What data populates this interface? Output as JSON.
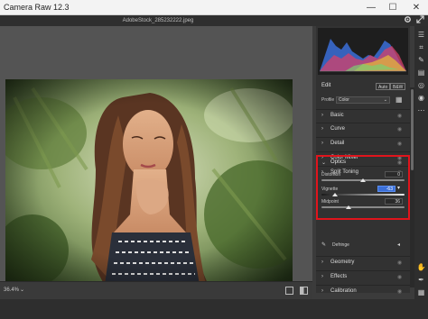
{
  "window": {
    "title": "Camera Raw 12.3",
    "minimize": "—",
    "maximize": "☐",
    "close": "✕"
  },
  "document": {
    "filename": "AdobeStock_285232222.jpeg"
  },
  "top_icons": {
    "settings": "gear-icon",
    "fullscreen": "expand-icon"
  },
  "status": {
    "zoom": "36.4%",
    "zoom_caret": "⌄"
  },
  "edit_panel": {
    "title": "Edit",
    "auto_button": "Auto",
    "bw_button": "B&W",
    "profile_label": "Profile",
    "profile_value": "Color",
    "profile_caret": "⌄"
  },
  "sections": [
    {
      "label": "Basic",
      "expanded": false
    },
    {
      "label": "Curve",
      "expanded": false
    },
    {
      "label": "Detail",
      "expanded": false
    },
    {
      "label": "Color Mixer",
      "expanded": false
    },
    {
      "label": "Split Toning",
      "expanded": false
    },
    {
      "label": "Optics",
      "expanded": true
    }
  ],
  "optics": {
    "sliders": [
      {
        "label": "Distortion",
        "value": "0",
        "position": 0.5
      },
      {
        "label": "Vignette",
        "value": "-63",
        "position": 0.19
      },
      {
        "label": "Midpoint",
        "value": "36",
        "position": 0.35
      }
    ],
    "defringe_label": "Defringe"
  },
  "lower_sections": [
    {
      "label": "Geometry"
    },
    {
      "label": "Effects"
    },
    {
      "label": "Calibration"
    }
  ],
  "tools": [
    "edit-sliders-icon",
    "crop-icon",
    "brush-icon",
    "graduated-filter-icon",
    "radial-filter-icon",
    "redeye-icon",
    "more-icon",
    "hand-icon",
    "eyedropper-icon",
    "grid-icon"
  ],
  "colors": {
    "accent_red": "#e0141c",
    "panel_bg": "#323232",
    "canvas_bg": "#545454",
    "vignette_track": "#5aa0e8"
  }
}
